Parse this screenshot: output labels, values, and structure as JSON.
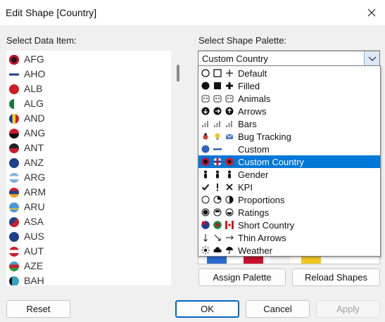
{
  "window": {
    "title": "Edit Shape [Country]"
  },
  "left": {
    "label": "Select Data Item:",
    "items": [
      {
        "code": "AFG",
        "flag": "afg"
      },
      {
        "code": "AHO",
        "flag": "aho"
      },
      {
        "code": "ALB",
        "flag": "alb"
      },
      {
        "code": "ALG",
        "flag": "alg"
      },
      {
        "code": "AND",
        "flag": "and"
      },
      {
        "code": "ANG",
        "flag": "ang"
      },
      {
        "code": "ANT",
        "flag": "ant"
      },
      {
        "code": "ANZ",
        "flag": "anz"
      },
      {
        "code": "ARG",
        "flag": "arg"
      },
      {
        "code": "ARM",
        "flag": "arm"
      },
      {
        "code": "ARU",
        "flag": "aru"
      },
      {
        "code": "ASA",
        "flag": "asa"
      },
      {
        "code": "AUS",
        "flag": "aus"
      },
      {
        "code": "AUT",
        "flag": "aut"
      },
      {
        "code": "AZE",
        "flag": "aze"
      },
      {
        "code": "BAH",
        "flag": "bah"
      }
    ]
  },
  "right": {
    "label": "Select Shape Palette:",
    "selected_value": "Custom Country",
    "options": [
      {
        "label": "Default",
        "icons": [
          "circle-outline-icon",
          "square-outline-icon",
          "plus-icon"
        ]
      },
      {
        "label": "Filled",
        "icons": [
          "circle-filled-icon",
          "square-filled-icon",
          "plus-bold-icon"
        ]
      },
      {
        "label": "Animals",
        "icons": [
          "animal-icon",
          "animal-icon",
          "animal-icon"
        ]
      },
      {
        "label": "Arrows",
        "icons": [
          "arrow-down-circle-icon",
          "arrow-right-circle-icon",
          "arrow-up-circle-icon"
        ]
      },
      {
        "label": "Bars",
        "icons": [
          "bars-icon",
          "bars-icon",
          "bars-icon"
        ]
      },
      {
        "label": "Bug Tracking",
        "icons": [
          "bug-icon",
          "bulb-icon",
          "mail-icon"
        ]
      },
      {
        "label": "Custom",
        "icons": [
          "blue-circle-icon",
          "blue-dash-icon"
        ]
      },
      {
        "label": "Custom Country",
        "icons": [
          "afg-flag-icon",
          "aho-flag-icon",
          "alb-flag-icon"
        ],
        "selected": true
      },
      {
        "label": "Gender",
        "icons": [
          "person-icon",
          "person-icon",
          "person-icon"
        ]
      },
      {
        "label": "KPI",
        "icons": [
          "check-icon",
          "exclamation-icon",
          "x-icon"
        ]
      },
      {
        "label": "Proportions",
        "icons": [
          "circle-empty-icon",
          "circle-quarter-icon",
          "circle-half-icon"
        ]
      },
      {
        "label": "Ratings",
        "icons": [
          "rating-full-icon",
          "rating-half-icon",
          "rating-low-icon"
        ]
      },
      {
        "label": "Short Country",
        "icons": [
          "aus-flag-icon",
          "bra-flag-icon",
          "can-flag-icon"
        ]
      },
      {
        "label": "Thin Arrows",
        "icons": [
          "thin-arrow-down-icon",
          "thin-arrow-diag-icon",
          "thin-arrow-right-icon"
        ]
      },
      {
        "label": "Weather",
        "icons": [
          "sun-icon",
          "cloud-icon",
          "umbrella-icon"
        ]
      }
    ],
    "assign_label": "Assign Palette",
    "reload_label": "Reload Shapes"
  },
  "footer": {
    "reset_label": "Reset",
    "ok_label": "OK",
    "cancel_label": "Cancel",
    "apply_label": "Apply"
  },
  "colors": {
    "selection": "#0078d7",
    "primary_border": "#0067c0"
  }
}
